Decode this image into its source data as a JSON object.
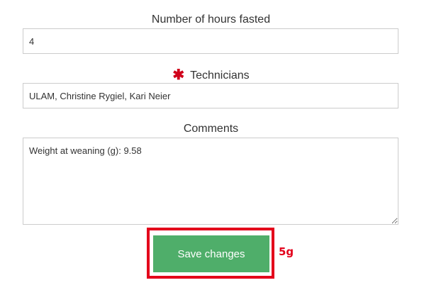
{
  "fields": {
    "hours_fasted": {
      "label": "Number of hours fasted",
      "value": "4"
    },
    "technicians": {
      "label": "Technicians",
      "value": "ULAM, Christine Rygiel, Kari Neier",
      "required_icon": "asterisk-icon",
      "required_glyph": "✱"
    },
    "comments": {
      "label": "Comments",
      "value": "Weight at weaning (g): 9.58"
    }
  },
  "actions": {
    "save_label": "Save changes"
  },
  "annotation": {
    "text": "5g"
  },
  "colors": {
    "button_bg": "#4fae6a",
    "highlight": "#e3001b",
    "required": "#d0021b"
  }
}
